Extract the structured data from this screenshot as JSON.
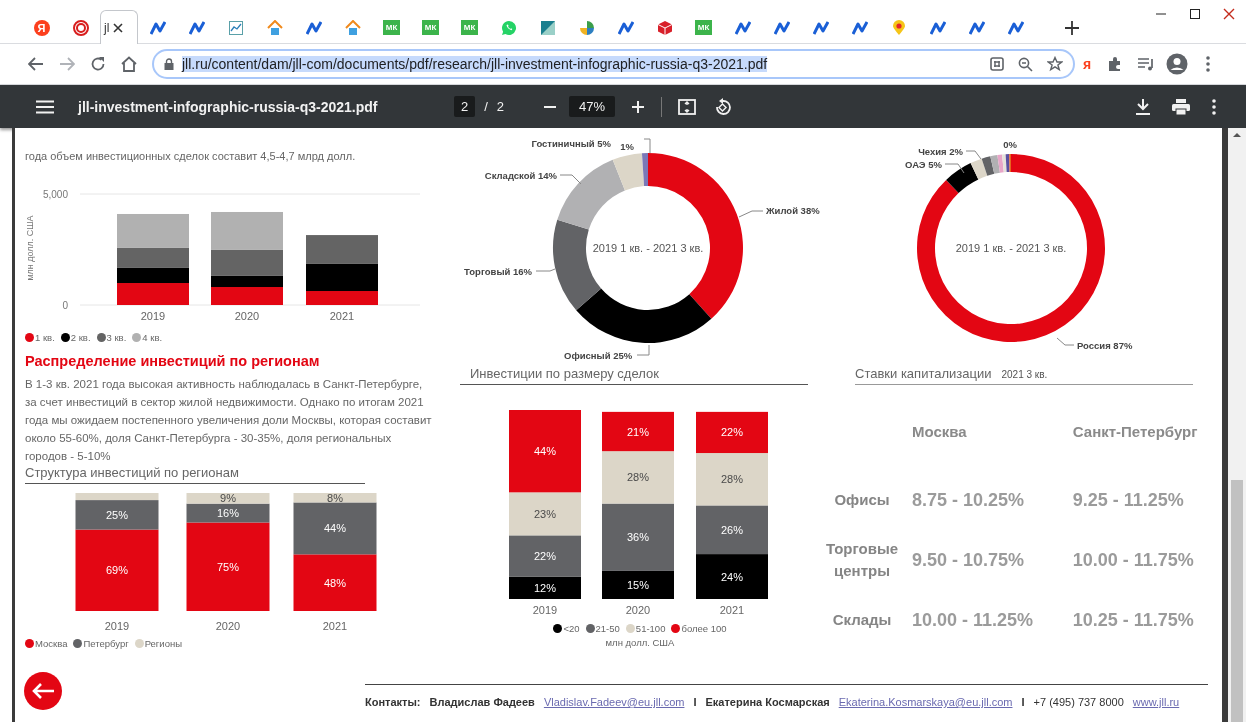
{
  "browser": {
    "tabs": [
      {
        "kind": "letter",
        "text": "Я",
        "selected": false
      },
      {
        "kind": "rings",
        "selected": false
      },
      {
        "kind": "page",
        "title": "jl",
        "selected": true
      },
      {
        "kind": "zigzag",
        "selected": false
      },
      {
        "kind": "zigzag",
        "selected": false
      },
      {
        "kind": "chart",
        "selected": false
      },
      {
        "kind": "house",
        "selected": false
      },
      {
        "kind": "zigzag",
        "selected": false
      },
      {
        "kind": "house",
        "selected": false
      },
      {
        "kind": "mk",
        "text": "МК",
        "selected": false
      },
      {
        "kind": "mk",
        "text": "МК",
        "selected": false
      },
      {
        "kind": "mk",
        "text": "МК",
        "selected": false
      },
      {
        "kind": "chat",
        "selected": false
      },
      {
        "kind": "split",
        "selected": false
      },
      {
        "kind": "pie",
        "selected": false
      },
      {
        "kind": "zigzag",
        "selected": false
      },
      {
        "kind": "cube",
        "selected": false
      },
      {
        "kind": "mk",
        "text": "МК",
        "selected": false
      },
      {
        "kind": "zigzag",
        "selected": false
      },
      {
        "kind": "zigzag",
        "selected": false
      },
      {
        "kind": "zigzag",
        "selected": false
      },
      {
        "kind": "zigzag",
        "selected": false
      },
      {
        "kind": "pin",
        "selected": false
      },
      {
        "kind": "zigzag",
        "selected": false
      },
      {
        "kind": "zigzag",
        "selected": false
      },
      {
        "kind": "zigzag",
        "selected": false
      }
    ]
  },
  "address_bar": {
    "url": "jll.ru/content/dam/jll-com/documents/pdf/research/jll-investment-infographic-russia-q3-2021.pdf",
    "selected": true,
    "extension_letter": "я"
  },
  "pdf_toolbar": {
    "title": "jll-investment-infographic-russia-q3-2021.pdf",
    "page": "2",
    "separator": "/",
    "page_count": "2",
    "zoom": "47%"
  },
  "page": {
    "intro_text": "года объем инвестиционных сделок составит 4,5-4,7 млрд долл.",
    "volume_chart": {
      "chart_data": {
        "type": "bar",
        "stacked": true,
        "ylabel": "млн долл. США",
        "categories": [
          "2019",
          "2020",
          "2021"
        ],
        "ylim": [
          0,
          5000
        ],
        "yticks": [
          {
            "value": 0,
            "label": "0"
          },
          {
            "value": 5000,
            "label": "5,000"
          }
        ],
        "series": [
          {
            "name": "1 кв.",
            "color": "#e30613",
            "values": [
              990,
              810,
              630
            ]
          },
          {
            "name": "2 кв.",
            "color": "#000000",
            "values": [
              680,
              500,
              1220
            ]
          },
          {
            "name": "3 кв.",
            "color": "#646464",
            "values": [
              900,
              1170,
              1300
            ]
          },
          {
            "name": "4 кв.",
            "color": "#b1b1b1",
            "values": [
              1530,
              1710,
              null
            ]
          }
        ]
      }
    },
    "regions_heading": "Распределение инвестиций по регионам",
    "regions_text": "В 1-3 кв. 2021 года высокая активность наблюдалась в Санкт-Петербурге, за счет инвестиций в сектор жилой недвижимости. Однако по итогам 2021 года мы ожидаем постепенного увеличения доли Москвы, которая составит около 55-60%, доля Санкт-Петербурга - 30-35%, доля региональных городов - 5-10%",
    "regions_chart": {
      "title": "Структура инвестиций по регионам",
      "chart_data": {
        "type": "bar",
        "stacked": true,
        "categories": [
          "2019",
          "2020",
          "2021"
        ],
        "series": [
          {
            "name": "Москва",
            "color": "#e30613",
            "values": [
              69,
              75,
              48
            ],
            "value_labels": [
              "69%",
              "75%",
              "48%"
            ]
          },
          {
            "name": "Петербург",
            "color": "#626366",
            "values": [
              25,
              16,
              44
            ],
            "value_labels": [
              "25%",
              "16%",
              "44%"
            ]
          },
          {
            "name": "Регионы",
            "color": "#dcd6c8",
            "values": [
              6,
              9,
              8
            ],
            "value_labels": [
              null,
              "9%",
              "8%"
            ]
          }
        ]
      }
    },
    "sector_donut": {
      "center_label": "2019 1 кв. - 2021 3 кв.",
      "chart_data": {
        "type": "donut",
        "categories": [
          "Жилой 38%",
          "Офисный 25%",
          "Торговый 16%",
          "Складской 14%",
          "Гостиничный 5%",
          "1%"
        ],
        "values": [
          38,
          25,
          16,
          14,
          5,
          1
        ],
        "colors": [
          "#e30613",
          "#000000",
          "#626366",
          "#b1b1b3",
          "#dcd6c8",
          "#7b78b8"
        ]
      }
    },
    "deal_size_chart": {
      "title": "Инвестиции по размеру сделок",
      "chart_data": {
        "type": "bar",
        "stacked": true,
        "xlabel": "млн долл. США",
        "categories": [
          "2019",
          "2020",
          "2021"
        ],
        "series": [
          {
            "name": "<20",
            "color": "#000000",
            "values": [
              12,
              15,
              24
            ],
            "value_labels": [
              "12%",
              "15%",
              "24%"
            ]
          },
          {
            "name": "21-50",
            "color": "#626366",
            "values": [
              22,
              36,
              26
            ],
            "value_labels": [
              "22%",
              "36%",
              "26%"
            ]
          },
          {
            "name": "51-100",
            "color": "#dcd6c8",
            "values": [
              23,
              28,
              28
            ],
            "value_labels": [
              "23%",
              "28%",
              "28%"
            ]
          },
          {
            "name": "более 100",
            "color": "#e30613",
            "values": [
              44,
              21,
              22
            ],
            "value_labels": [
              "44%",
              "21%",
              "22%"
            ]
          }
        ]
      }
    },
    "country_donut": {
      "center_label": "2019 1 кв. - 2021 3 кв.",
      "chart_data": {
        "type": "donut",
        "categories": [
          "Россия 87%",
          "ОАЭ 5%",
          "Чехия 2%",
          null,
          null,
          null,
          null,
          null,
          "0%"
        ],
        "values": [
          87,
          5,
          2,
          1.5,
          1.2,
          0.8,
          0.6,
          0.6,
          0.3
        ],
        "colors": [
          "#e30613",
          "#000000",
          "#dcd6c8",
          "#626366",
          "#b1b1b3",
          "#e8a6c8",
          "#e6e2da",
          "#5a4fa0",
          "#e8641e"
        ]
      }
    },
    "cap_rates": {
      "title": "Ставки капитализации",
      "period": "2021 3 кв.",
      "columns": [
        "Москва",
        "Санкт-Петербург"
      ],
      "rows": [
        {
          "label": "Офисы",
          "values": [
            "8.75 - 10.25%",
            "9.25 - 11.25%"
          ]
        },
        {
          "label": "Торговые центры",
          "values": [
            "9.50 - 10.75%",
            "10.00 - 11.75%"
          ]
        },
        {
          "label": "Склады",
          "values": [
            "10.00 - 11.25%",
            "10.25 - 11.75%"
          ]
        }
      ]
    },
    "contacts": [
      {
        "kind": "label",
        "text": "Контакты:"
      },
      {
        "kind": "name",
        "text": "Владислав Фадеев"
      },
      {
        "kind": "email",
        "text": "Vladislav.Fadeev@eu.jll.com"
      },
      {
        "kind": "separator",
        "text": "I"
      },
      {
        "kind": "name",
        "text": "Екатерина Космарская"
      },
      {
        "kind": "email",
        "text": "Ekaterina.Kosmarskaya@eu.jll.com"
      },
      {
        "kind": "separator",
        "text": "I"
      },
      {
        "kind": "phone",
        "text": "+7 (495) 737 8000"
      },
      {
        "kind": "link",
        "text": "www.jll.ru"
      }
    ]
  }
}
